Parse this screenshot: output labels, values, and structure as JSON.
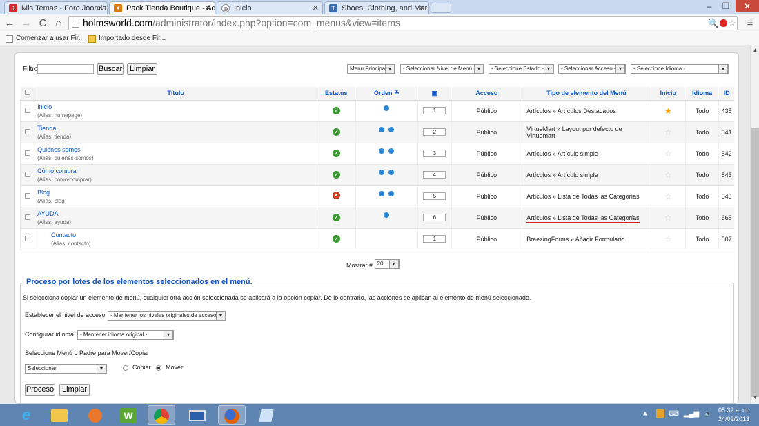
{
  "browser": {
    "tabs": [
      {
        "label": "Mis Temas - Foro Joomla!",
        "icon": "joomla-icon",
        "color": "#d5262d"
      },
      {
        "label": "Pack Tienda Boutique - Ad",
        "icon": "joomla-admin-icon",
        "color": "#e07b00"
      },
      {
        "label": "Inicio",
        "icon": "globe-icon",
        "color": "#888888"
      },
      {
        "label": "Shoes, Clothing, and Mor",
        "icon": "t-icon",
        "color": "#3b6db3"
      }
    ],
    "url_host": "holmsworld.com",
    "url_path": "/administrator/index.php?option=com_menus&view=items",
    "bookmarks": [
      "Comenzar a usar Fir...",
      "Importado desde Fir..."
    ]
  },
  "filter": {
    "label": "Filtro:",
    "search_label": "Buscar",
    "clear_label": "Limpiar",
    "menu_select": "Menu Principal",
    "level_select": "- Seleccionar Nivel de Menú -",
    "state_select": "- Seleccione Estado -",
    "access_select": "- Seleccionar Acceso -",
    "language_select": "- Seleccione Idioma -"
  },
  "table": {
    "headers": {
      "title": "Título",
      "status": "Estatus",
      "order": "Orden",
      "access": "Acceso",
      "type": "Tipo de elemento del Menú",
      "home": "Inicio",
      "language": "Idioma",
      "id": "ID"
    },
    "rows": [
      {
        "title": "Inicio",
        "alias": "(Alias: homepage)",
        "order": "1",
        "access": "Público",
        "type": "Artículos » Artículos Destacados",
        "language": "Todo",
        "id": "435"
      },
      {
        "title": "Tienda",
        "alias": "(Alias: tienda)",
        "order": "2",
        "access": "Público",
        "type": "VirtueMart » Layout por defecto de Virtuemart",
        "language": "Todo",
        "id": "541"
      },
      {
        "title": "Quiénes somos",
        "alias": "(Alias: quienes-somos)",
        "order": "3",
        "access": "Público",
        "type": "Artículos » Artículo simple",
        "language": "Todo",
        "id": "542"
      },
      {
        "title": "Cómo comprar",
        "alias": "(Alias: como-comprar)",
        "order": "4",
        "access": "Público",
        "type": "Artículos » Artículo simple",
        "language": "Todo",
        "id": "543"
      },
      {
        "title": "Blog",
        "alias": "(Alias: blog)",
        "order": "5",
        "access": "Público",
        "type": "Artículos » Lista de Todas las Categorías",
        "language": "Todo",
        "id": "545"
      },
      {
        "title": "AYUDA",
        "alias": "(Alias: ayuda)",
        "order": "6",
        "access": "Público",
        "type": "Artículos » Lista de Todas las Categorías",
        "language": "Todo",
        "id": "665"
      },
      {
        "title": "Contacto",
        "alias": "(Alias: contacto)",
        "order": "1",
        "access": "Público",
        "type": "BreezingForms » Añadir Formulario",
        "language": "Todo",
        "id": "507"
      }
    ],
    "show_label": "Mostrar #",
    "show_value": "20"
  },
  "batch": {
    "legend": "Proceso por lotes de los elementos seleccionados en el menú.",
    "description": "Si selecciona copiar un elemento de menú, cualquier otra acción seleccionada se aplicará a la opción copiar. De lo contrario, las acciones se aplican al elemento de menú seleccionado.",
    "access_label": "Establecer el nivel de acceso",
    "access_value": "- Mantener los niveles originales de acceso -",
    "language_label": "Configurar idioma",
    "language_value": "- Mantener idioma original -",
    "move_label": "Seleccione Menú o Padre para Mover/Copiar",
    "move_value": "Seleccionar",
    "copy_label": "Copiar",
    "move_option": "Mover",
    "process_label": "Proceso",
    "clear_label": "Limpiar"
  },
  "taskbar": {
    "time": "05:32 a. m.",
    "date": "24/09/2013"
  }
}
